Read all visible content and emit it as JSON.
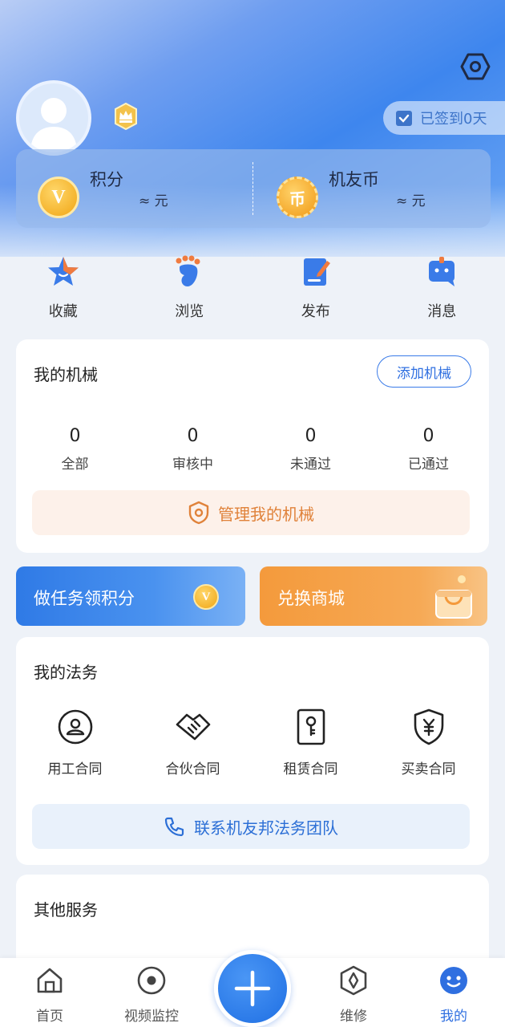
{
  "header": {
    "signin_text": "已签到0天"
  },
  "points": [
    {
      "title": "积分",
      "value": "≈ 元",
      "coin_glyph": "V"
    },
    {
      "title": "机友币",
      "value": "≈ 元",
      "coin_glyph": "币"
    }
  ],
  "quick_actions": [
    {
      "label": "收藏",
      "icon": "star-icon"
    },
    {
      "label": "浏览",
      "icon": "footprint-icon"
    },
    {
      "label": "发布",
      "icon": "publish-icon"
    },
    {
      "label": "消息",
      "icon": "message-icon"
    }
  ],
  "machinery": {
    "title": "我的机械",
    "add_label": "添加机械",
    "stats": [
      {
        "value": "0",
        "label": "全部"
      },
      {
        "value": "0",
        "label": "审核中"
      },
      {
        "value": "0",
        "label": "未通过"
      },
      {
        "value": "0",
        "label": "已通过"
      }
    ],
    "manage_label": "管理我的机械"
  },
  "banners": {
    "tasks": "做任务领积分",
    "tasks_coin": "V",
    "shop": "兑换商城"
  },
  "legal": {
    "title": "我的法务",
    "items": [
      {
        "label": "用工合同",
        "icon": "person-contract-icon"
      },
      {
        "label": "合伙合同",
        "icon": "handshake-icon"
      },
      {
        "label": "租赁合同",
        "icon": "key-contract-icon"
      },
      {
        "label": "买卖合同",
        "icon": "yuan-shield-icon"
      }
    ],
    "contact_label": "联系机友邦法务团队"
  },
  "other_services": {
    "title": "其他服务"
  },
  "tabbar": {
    "items": [
      {
        "label": "首页",
        "icon": "home-icon"
      },
      {
        "label": "视频监控",
        "icon": "video-monitor-icon"
      },
      {
        "label": "维修",
        "icon": "repair-icon"
      },
      {
        "label": "我的",
        "icon": "profile-icon",
        "active": true
      }
    ]
  },
  "colors": {
    "primary": "#2f6fe0",
    "orange": "#e0823a",
    "page_bg": "#eef2f8"
  }
}
